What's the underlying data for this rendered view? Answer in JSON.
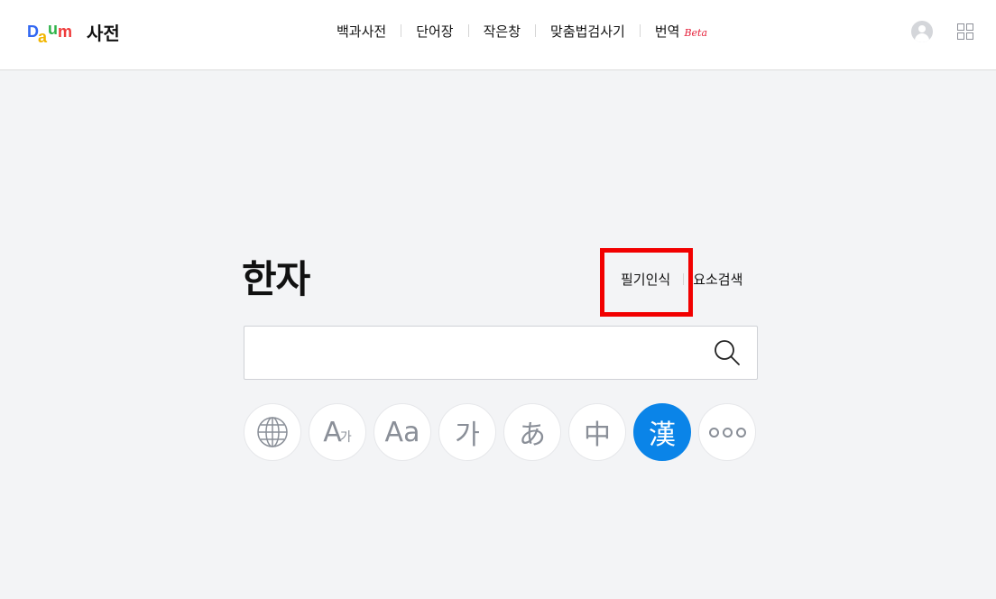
{
  "header": {
    "logo_text": "Daum",
    "logo_letters": [
      {
        "ch": "D",
        "color": "#3268f2"
      },
      {
        "ch": "a",
        "color": "#f2b600"
      },
      {
        "ch": "u",
        "color": "#2fb34a"
      },
      {
        "ch": "m",
        "color": "#ef3b3b"
      }
    ],
    "service_title": "사전",
    "nav": [
      {
        "label": "백과사전"
      },
      {
        "label": "단어장"
      },
      {
        "label": "작은창"
      },
      {
        "label": "맞춤법검사기"
      },
      {
        "label": "번역",
        "badge": "Beta"
      }
    ],
    "icons": {
      "profile": "profile-avatar-icon",
      "apps": "apps-grid-icon"
    }
  },
  "main": {
    "title": "한자",
    "links": [
      {
        "label": "필기인식"
      },
      {
        "label": "요소검색"
      }
    ],
    "search": {
      "placeholder": "",
      "value": "",
      "icon": "search-icon"
    },
    "dictionaries": [
      {
        "name": "all-languages",
        "icon": "globe-icon",
        "glyph": "",
        "active": false
      },
      {
        "name": "english-korean",
        "glyph": "A",
        "sub": "가",
        "active": false
      },
      {
        "name": "english",
        "glyph": "Aa",
        "active": false
      },
      {
        "name": "korean",
        "glyph": "가",
        "active": false
      },
      {
        "name": "japanese",
        "glyph": "あ",
        "active": false
      },
      {
        "name": "chinese",
        "glyph": "中",
        "active": false
      },
      {
        "name": "hanja",
        "glyph": "漢",
        "active": true
      },
      {
        "name": "more",
        "icon": "more-dots-icon",
        "glyph": "",
        "active": false
      }
    ]
  },
  "colors": {
    "background": "#f3f4f6",
    "accent": "#0a84e8",
    "highlight": "#f20000",
    "beta": "#e5213b"
  }
}
